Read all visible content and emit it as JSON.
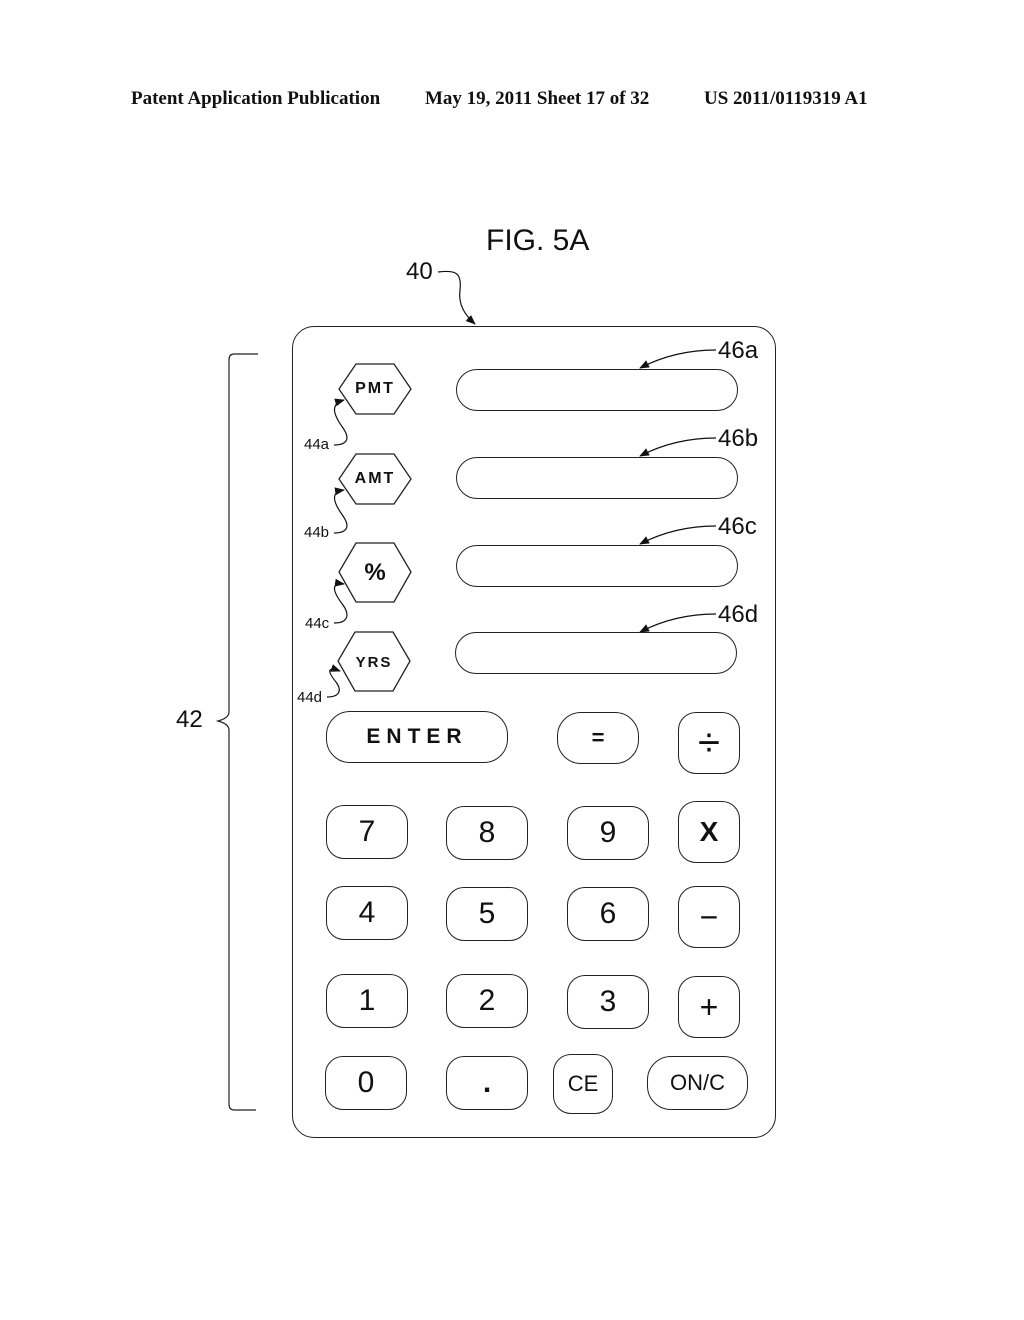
{
  "header": {
    "publication": "Patent Application Publication",
    "date_sheet": "May 19, 2011  Sheet 17 of 32",
    "number": "US 2011/0119319 A1"
  },
  "figure": {
    "title": "FIG. 5A"
  },
  "references": {
    "device": "40",
    "keypad_group": "42",
    "function_keys": [
      "44a",
      "44b",
      "44c",
      "44d"
    ],
    "displays": [
      "46a",
      "46b",
      "46c",
      "46d"
    ]
  },
  "function_keys": [
    {
      "label": "PMT",
      "icon": "hexagon"
    },
    {
      "label": "AMT",
      "icon": "hexagon"
    },
    {
      "label": "%",
      "icon": "hexagon"
    },
    {
      "label": "YRS",
      "icon": "hexagon"
    }
  ],
  "display_fields": [
    {
      "value": ""
    },
    {
      "value": ""
    },
    {
      "value": ""
    },
    {
      "value": ""
    }
  ],
  "keys": {
    "enter": "ENTER",
    "equals": "=",
    "divide": "÷",
    "multiply": "X",
    "minus": "−",
    "plus": "+",
    "seven": "7",
    "eight": "8",
    "nine": "9",
    "four": "4",
    "five": "5",
    "six": "6",
    "one": "1",
    "two": "2",
    "three": "3",
    "zero": "0",
    "decimal": ".",
    "clear_entry": "CE",
    "on_clear": "ON/C"
  }
}
